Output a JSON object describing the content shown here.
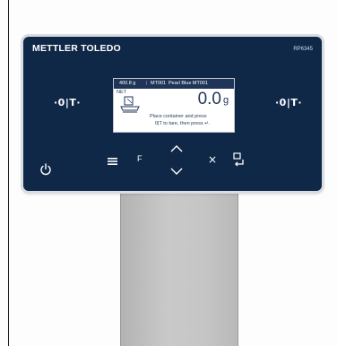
{
  "terminal": {
    "brand": "METTLER TOLEDO",
    "model": "RP6345",
    "zero_tare_left": "·0|T·",
    "zero_tare_right": "·0|T·"
  },
  "screen": {
    "capacity": "400.8 g",
    "separator": "|",
    "item_code": "MT001",
    "item_name": "Pearl Blue MT001",
    "mode_label": "NET",
    "weight_value": "0.0",
    "unit": "g",
    "instruction_line1": "Place container and press",
    "instruction_line2": "0|T to tare, then press ↵."
  },
  "keys": {
    "f_label": "F",
    "close_label": "×"
  },
  "icons": {
    "power": "power-icon",
    "menu": "menu-icon",
    "up": "chevron-up-icon",
    "down": "chevron-down-icon",
    "enter": "enter-icon",
    "container": "container-icon"
  },
  "colors": {
    "terminal_bg": "#102848",
    "screen_header": "#1f3558",
    "stand": "#c2c2c2"
  }
}
